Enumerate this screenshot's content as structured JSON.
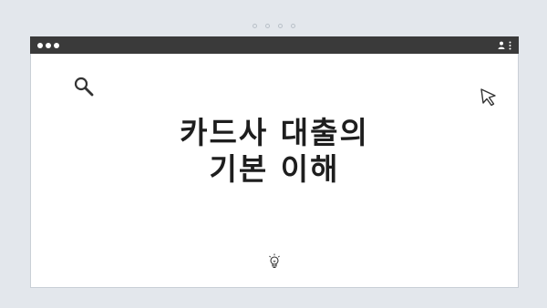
{
  "window": {
    "title_lines": [
      "카드사 대출의",
      "기본 이해"
    ]
  },
  "icons": {
    "search": "search-icon",
    "cursor": "cursor-icon",
    "bulb": "lightbulb-icon",
    "user": "user-icon",
    "menu": "kebab-menu-icon"
  },
  "colors": {
    "background": "#e3e7ec",
    "titlebar": "#3a3a3a",
    "window": "#ffffff",
    "text": "#1e1e1e"
  }
}
